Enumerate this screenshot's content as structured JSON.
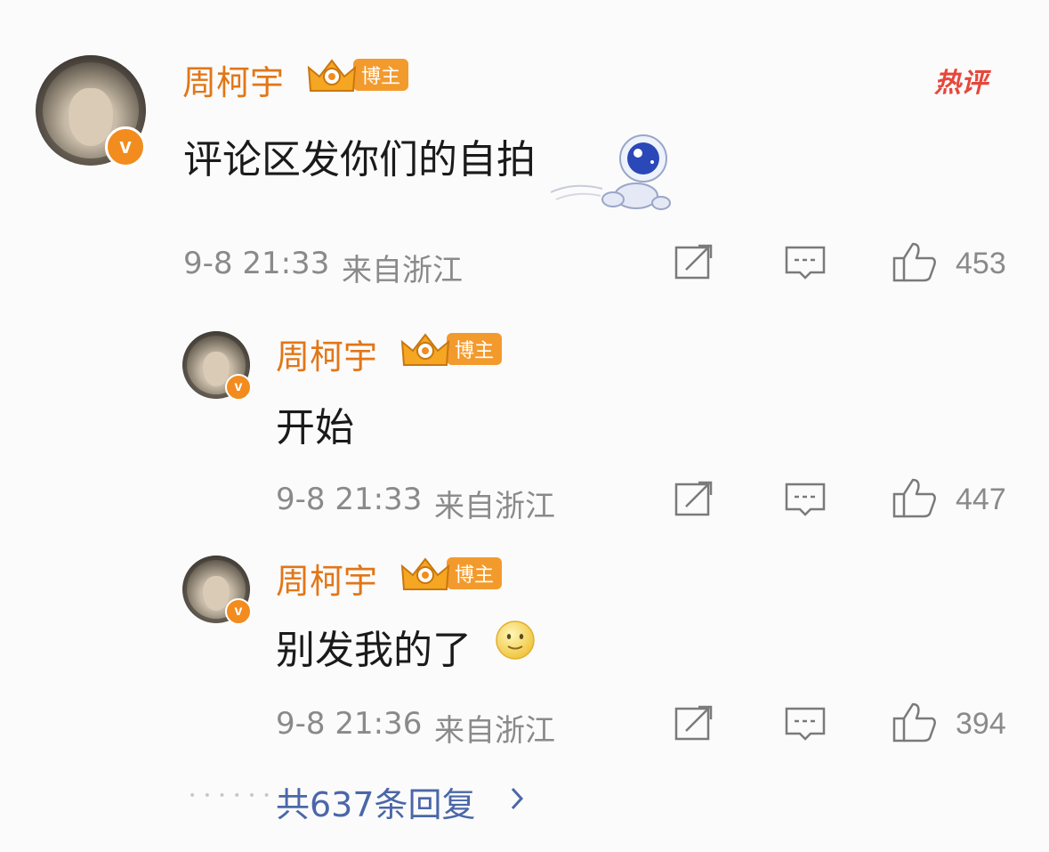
{
  "hot_label": "热评",
  "comment": {
    "user": "周柯宇",
    "badge": "博主",
    "text": "评论区发你们的自拍",
    "time": "9-8 21:33",
    "location": "来自浙江",
    "likes": "453"
  },
  "replies": [
    {
      "user": "周柯宇",
      "badge": "博主",
      "text": "开始",
      "time": "9-8 21:33",
      "location": "来自浙江",
      "likes": "447"
    },
    {
      "user": "周柯宇",
      "badge": "博主",
      "text": "别发我的了",
      "time": "9-8 21:36",
      "location": "来自浙江",
      "likes": "394"
    }
  ],
  "more_replies": "共637条回复",
  "verified_glyph": "v",
  "colors": {
    "name": "#e27617",
    "badge": "#f39a2d",
    "hot": "#e8463a",
    "link": "#4a67a8"
  }
}
